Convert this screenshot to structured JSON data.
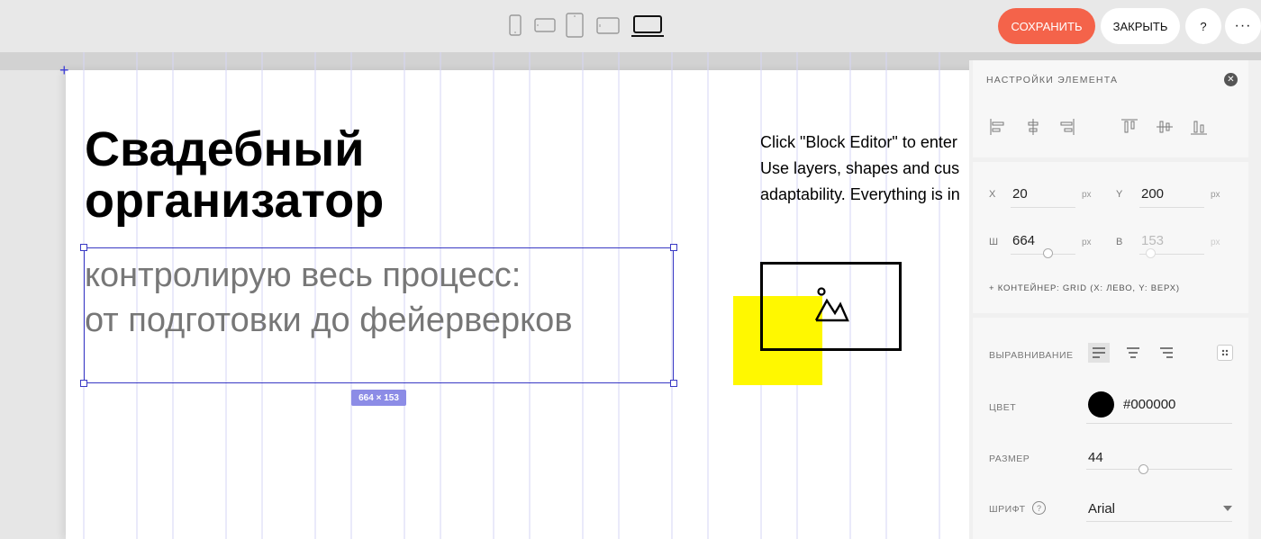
{
  "toolbar": {
    "devices": [
      "mobile-portrait",
      "mobile-landscape",
      "tablet-portrait",
      "tablet-landscape",
      "desktop"
    ],
    "active_device": "desktop",
    "save_label": "СОХРАНИТЬ",
    "close_label": "ЗАКРЫТЬ",
    "help_label": "?",
    "more_label": "···",
    "accent_color": "#f4634a"
  },
  "canvas": {
    "heading": "Свадебный организатор",
    "subtext_line1": "контролирую весь процесс:",
    "subtext_line2": "от подготовки до фейерверков",
    "selection_size": "664 × 153",
    "intro_line1": "Click \"Block Editor\" to enter",
    "intro_line2": "Use layers, shapes and cus",
    "intro_line3": "adaptability. Everything is in",
    "image_icon": "image-placeholder-icon",
    "decor_color": "#fff800"
  },
  "panel": {
    "title": "НАСТРОЙКИ ЭЛЕМЕНТА",
    "x_label": "X",
    "x_value": "20",
    "y_label": "Y",
    "y_value": "200",
    "w_label": "Ш",
    "w_value": "664",
    "h_label": "В",
    "h_value": "153",
    "unit": "px",
    "container_info": "+ КОНТЕЙНЕР: GRID (X: ЛЕВО, Y: ВЕРХ)",
    "align_label": "ВЫРАВНИВАНИЕ",
    "color_label": "ЦВЕТ",
    "color_value": "#000000",
    "size_label": "РАЗМЕР",
    "size_value": "44",
    "font_label": "ШРИФТ",
    "font_value": "Arial"
  }
}
